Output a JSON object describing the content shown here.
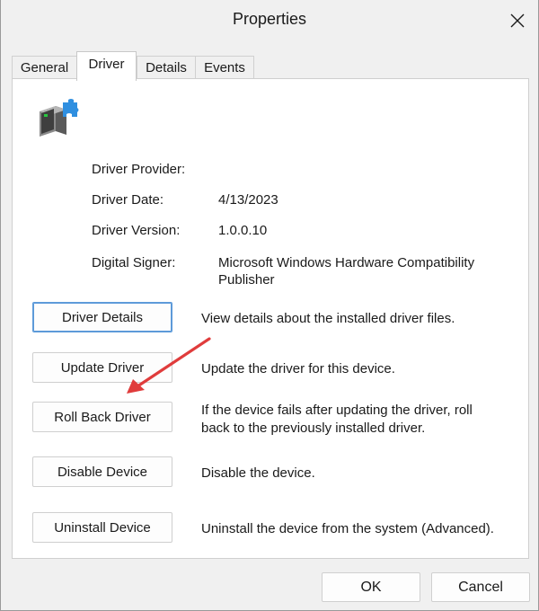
{
  "window": {
    "title": "Properties"
  },
  "tabs": [
    {
      "label": "General"
    },
    {
      "label": "Driver"
    },
    {
      "label": "Details"
    },
    {
      "label": "Events"
    }
  ],
  "driver_info": {
    "provider_label": "Driver Provider:",
    "provider_value": "",
    "date_label": "Driver Date:",
    "date_value": "4/13/2023",
    "version_label": "Driver Version:",
    "version_value": "1.0.0.10",
    "signer_label": "Digital Signer:",
    "signer_value_line1": "Microsoft Windows Hardware Compatibility",
    "signer_value_line2": "Publisher"
  },
  "actions": [
    {
      "label": "Driver Details",
      "description": "View details about the installed driver files."
    },
    {
      "label": "Update Driver",
      "description": "Update the driver for this device."
    },
    {
      "label": "Roll Back Driver",
      "description_line1": "If the device fails after updating the driver, roll",
      "description_line2": "back to the previously installed driver."
    },
    {
      "label": "Disable Device",
      "description": "Disable the device."
    },
    {
      "label": "Uninstall Device",
      "description": "Uninstall the device from the system (Advanced)."
    }
  ],
  "dialog_buttons": {
    "ok": "OK",
    "cancel": "Cancel"
  },
  "icons": {
    "close": "close-icon",
    "device": "device-icon",
    "annotation": "annotation-arrow-icon"
  },
  "colors": {
    "focus_border": "#5d9ad9",
    "annotation_arrow": "#e03c3c",
    "device_accent": "#2f8fe0"
  }
}
